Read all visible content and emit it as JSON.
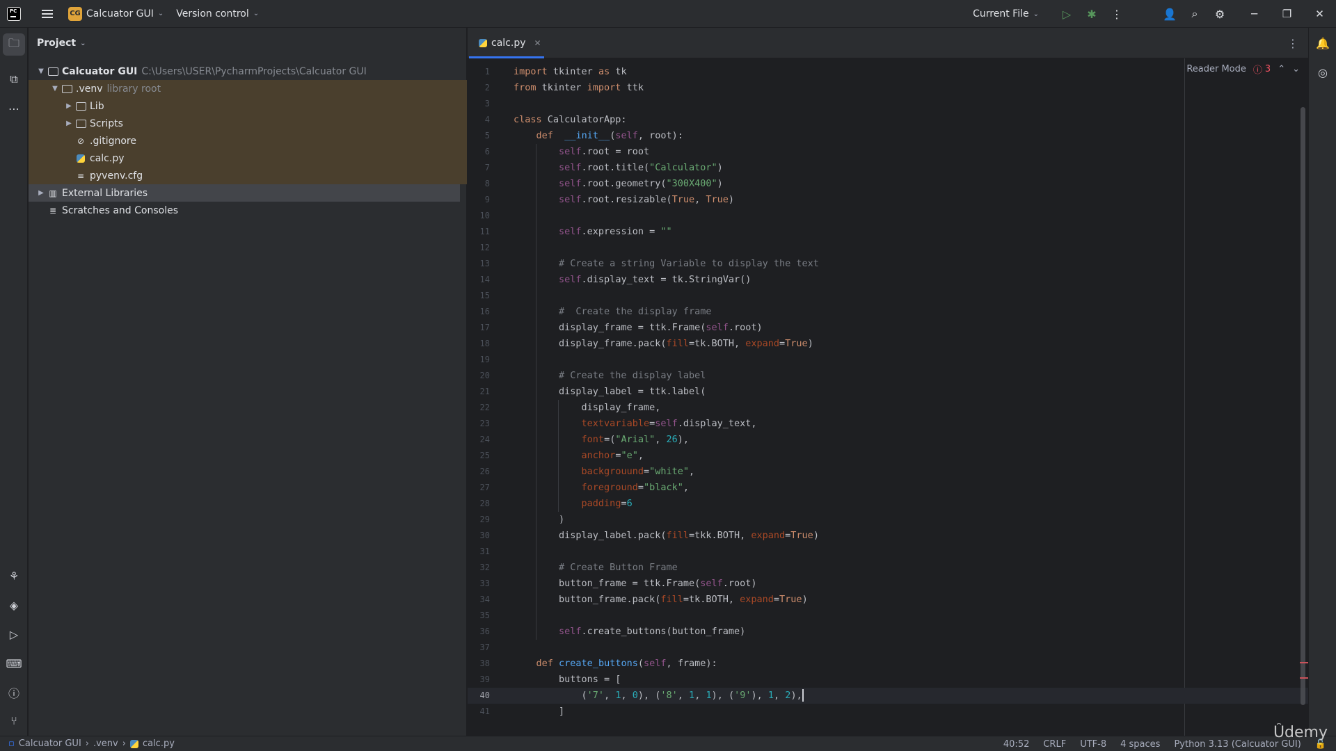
{
  "titlebar": {
    "project_badge": "CG",
    "project_name": "Calcuator GUI",
    "version_control": "Version control",
    "run_config": "Current File"
  },
  "project_panel": {
    "title": "Project",
    "tree": [
      {
        "label": "Calcuator GUI",
        "hint": "C:\\Users\\USER\\PycharmProjects\\Calcuator GUI",
        "icon": "folder-icon",
        "arrow": "down"
      },
      {
        "label": ".venv",
        "hint": "library root",
        "icon": "folder-icon",
        "arrow": "down"
      },
      {
        "label": "Lib",
        "hint": "",
        "icon": "folder-icon",
        "arrow": "right"
      },
      {
        "label": "Scripts",
        "hint": "",
        "icon": "folder-icon",
        "arrow": "right"
      },
      {
        "label": ".gitignore",
        "hint": "",
        "icon": "ignore-file-icon",
        "arrow": ""
      },
      {
        "label": "calc.py",
        "hint": "",
        "icon": "python-file-icon",
        "arrow": ""
      },
      {
        "label": "pyvenv.cfg",
        "hint": "",
        "icon": "text-file-icon",
        "arrow": ""
      },
      {
        "label": "External Libraries",
        "hint": "",
        "icon": "library-icon",
        "arrow": "right"
      },
      {
        "label": "Scratches and Consoles",
        "hint": "",
        "icon": "scratch-icon",
        "arrow": ""
      }
    ]
  },
  "editor": {
    "tab_label": "calc.py",
    "reader_mode": "Reader Mode",
    "error_count": "3",
    "current_line": 40,
    "lines": [
      "import tkinter as tk",
      "from tkinter import ttk",
      "",
      "class CalculatorApp:",
      "    def  __init__(self, root):",
      "        self.root = root",
      "        self.root.title(\"Calculator\")",
      "        self.root.geometry(\"300X400\")",
      "        self.root.resizable(True, True)",
      "",
      "        self.expression = \"\"",
      "",
      "        # Create a string Variable to display the text",
      "        self.display_text = tk.StringVar()",
      "",
      "        #  Create the display frame",
      "        display_frame = ttk.Frame(self.root)",
      "        display_frame.pack(fill=tk.BOTH, expand=True)",
      "",
      "        # Create the display label",
      "        display_label = ttk.label(",
      "            display_frame,",
      "            textvariable=self.display_text,",
      "            font=(\"Arial\", 26),",
      "            anchor=\"e\",",
      "            backgrouund=\"white\",",
      "            foreground=\"black\",",
      "            padding=6",
      "        )",
      "        display_label.pack(fill=tkk.BOTH, expand=True)",
      "",
      "        # Create Button Frame",
      "        button_frame = ttk.Frame(self.root)",
      "        button_frame.pack(fill=tk.BOTH, expand=True)",
      "",
      "        self.create_buttons(button_frame)",
      "",
      "    def create_buttons(self, frame):",
      "        buttons = [",
      "            ('7', 1, 0), ('8', 1, 1), ('9'), 1, 2),",
      "        ]"
    ]
  },
  "statusbar": {
    "crumbs": [
      "Calcuator GUI",
      ".venv",
      "calc.py"
    ],
    "position": "40:52",
    "line_sep": "CRLF",
    "encoding": "UTF-8",
    "indent": "4 spaces",
    "interpreter": "Python 3.13 (Calcuator GUI)"
  },
  "watermark": "Ûdemy"
}
